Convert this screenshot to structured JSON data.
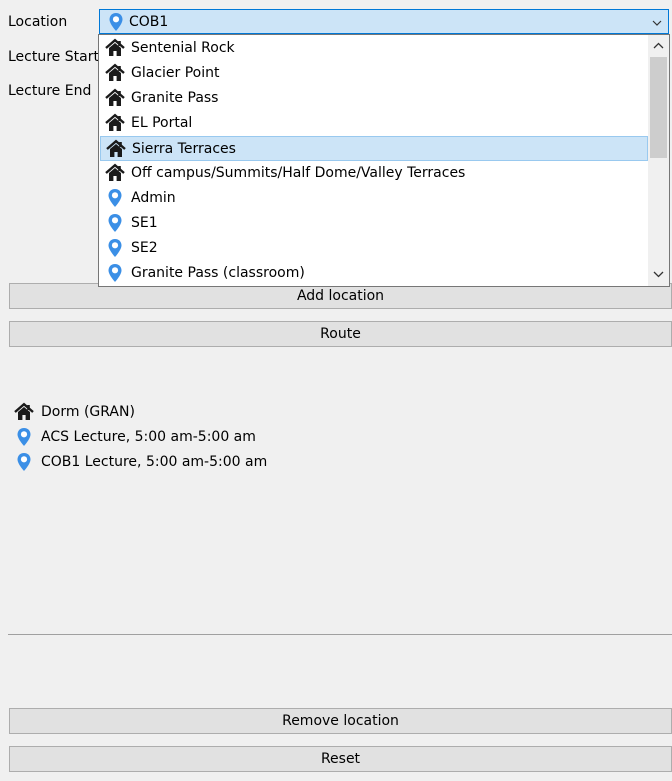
{
  "form": {
    "location_label": "Location",
    "lecture_start_label": "Lecture Start",
    "lecture_end_label": "Lecture End"
  },
  "location_combo": {
    "selected_value": "COB1",
    "selected_icon": "map-pin-icon"
  },
  "dropdown": {
    "items": [
      {
        "label": "Sentenial Rock",
        "icon": "home-icon",
        "selected": false
      },
      {
        "label": "Glacier Point",
        "icon": "home-icon",
        "selected": false
      },
      {
        "label": "Granite Pass",
        "icon": "home-icon",
        "selected": false
      },
      {
        "label": "EL Portal",
        "icon": "home-icon",
        "selected": false
      },
      {
        "label": "Sierra Terraces",
        "icon": "home-icon",
        "selected": true
      },
      {
        "label": "Off campus/Summits/Half Dome/Valley Terraces",
        "icon": "home-icon",
        "selected": false
      },
      {
        "label": "Admin",
        "icon": "map-pin-icon",
        "selected": false
      },
      {
        "label": "SE1",
        "icon": "map-pin-icon",
        "selected": false
      },
      {
        "label": "SE2",
        "icon": "map-pin-icon",
        "selected": false
      },
      {
        "label": "Granite Pass (classroom)",
        "icon": "map-pin-icon",
        "selected": false
      }
    ]
  },
  "buttons": {
    "add_location": "Add location",
    "route": "Route",
    "remove_location": "Remove location",
    "reset": "Reset"
  },
  "route_list": {
    "items": [
      {
        "label": "Dorm (GRAN)",
        "icon": "home-icon"
      },
      {
        "label": "ACS Lecture, 5:00 am-5:00 am",
        "icon": "map-pin-icon"
      },
      {
        "label": "COB1 Lecture, 5:00 am-5:00 am",
        "icon": "map-pin-icon"
      }
    ]
  },
  "colors": {
    "accent": "#0078d7",
    "selection_bg": "#cce4f7",
    "pin_blue": "#3b8fe6",
    "home_dark": "#1a1a1a"
  }
}
